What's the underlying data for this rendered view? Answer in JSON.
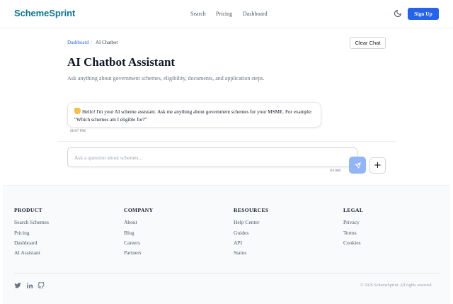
{
  "header": {
    "logo": "SchemeSprint",
    "nav": [
      "Search",
      "Pricing",
      "Dashboard"
    ],
    "signup_label": "Sign Up"
  },
  "breadcrumb": {
    "root": "Dashboard",
    "separator": "/",
    "current": "AI Chatbot"
  },
  "clear_label": "Clear Chat",
  "page": {
    "title": "AI Chatbot Assistant",
    "subtitle": "Ask anything about government schemes, eligibility, documents, and application steps."
  },
  "messages": [
    {
      "sender": "assistant",
      "text": "Hello! I'm your AI scheme assistant. Ask me anything about government schemes for your MSME. For example: \"Which schemes am I eligible for?\"",
      "time": "06:07 PM"
    }
  ],
  "input": {
    "placeholder": "Ask a question about schemes...",
    "value": "",
    "counter": "0/1000"
  },
  "footer": {
    "columns": [
      {
        "heading": "PRODUCT",
        "links": [
          "Search Schemes",
          "Pricing",
          "Dashboard",
          "AI Assistant"
        ]
      },
      {
        "heading": "COMPANY",
        "links": [
          "About",
          "Blog",
          "Careers",
          "Partners"
        ]
      },
      {
        "heading": "RESOURCES",
        "links": [
          "Help Center",
          "Guides",
          "API",
          "Status"
        ]
      },
      {
        "heading": "LEGAL",
        "links": [
          "Privacy",
          "Terms",
          "Cookies"
        ]
      }
    ],
    "social": [
      "twitter-icon",
      "linkedin-icon",
      "github-icon"
    ],
    "copyright": "© 2026 SchemeSprint. All rights reserved."
  },
  "colors": {
    "brand": "#0e7490",
    "primary": "#2563eb",
    "send_disabled": "#93b4f5"
  }
}
